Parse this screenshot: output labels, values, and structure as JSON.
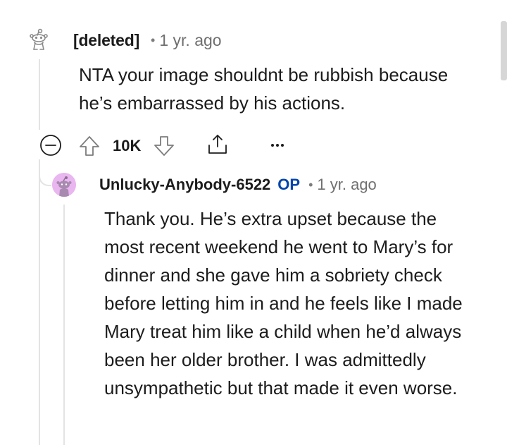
{
  "comment_1": {
    "author": "[deleted]",
    "separator": "•",
    "time": "1 yr. ago",
    "body": "NTA your image shouldnt be rubbish because he’s embarrassed by his actions.",
    "votes": "10K",
    "avatar_icon": "deleted-user-snoo-icon"
  },
  "actions": {
    "collapse_icon": "collapse-minus-icon",
    "upvote_icon": "upvote-arrow-icon",
    "downvote_icon": "downvote-arrow-icon",
    "share_icon": "share-icon",
    "more_icon": "more-options-icon",
    "more_label": "•••"
  },
  "comment_2": {
    "author": "Unlucky-Anybody-6522",
    "badge": "OP",
    "separator": "•",
    "time": "1 yr. ago",
    "body": "Thank you. He’s extra upset because the most recent weekend he went to Mary’s for dinner and she gave him a sobriety check before letting him in and he feels like I made Mary treat him like a child when he’d always been her older brother. I was admittedly unsympathetic but that made it even worse.",
    "avatar_color": "#e9b6f0",
    "badge_color": "#0045ac"
  }
}
